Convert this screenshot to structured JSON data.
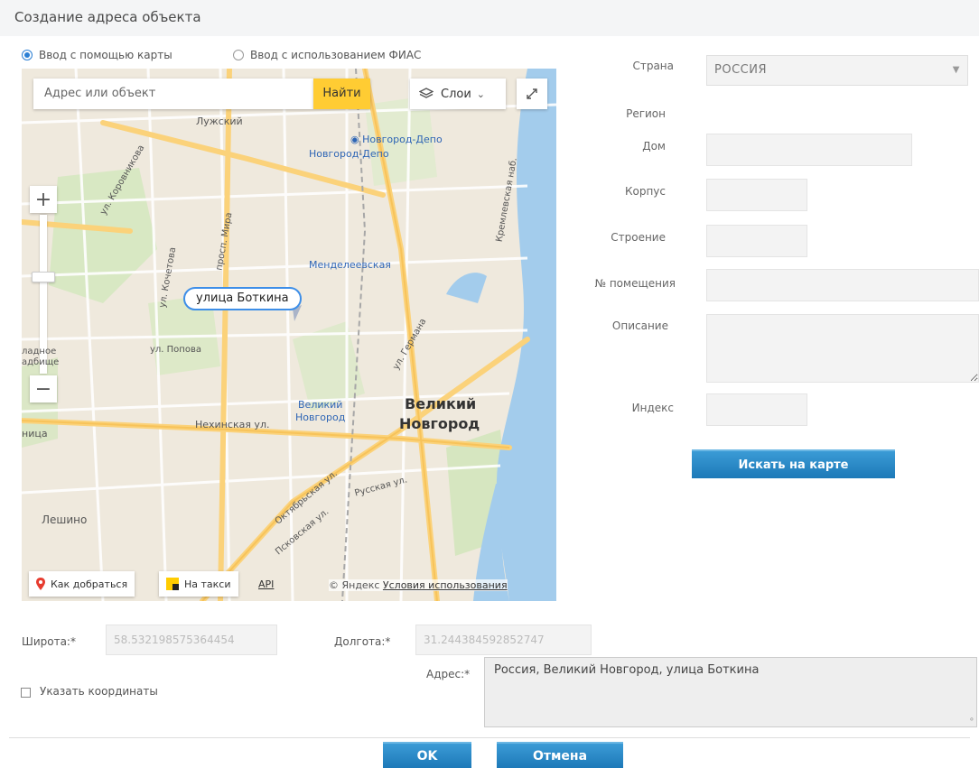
{
  "dialog": {
    "title": "Создание адреса объекта"
  },
  "input_mode": {
    "map_option": "Ввод с помощью карты",
    "fias_option": "Ввод с использованием ФИАС",
    "selected": "map"
  },
  "map": {
    "search_placeholder": "Адрес или объект",
    "find_label": "Найти",
    "layers_label": "Слои",
    "labels": {
      "luzhsky": "Лужский",
      "novgorod_depo_1": "Новгород-Депо",
      "novgorod_depo_2": "Новгород-Депо",
      "mendeleevskaya": "Менделеевская",
      "veliky_novgorod_station_1": "Великий",
      "veliky_novgorod_station_2": "Новгород",
      "city_1": "Великий",
      "city_2": "Новгород",
      "nekhinskaya": "Нехинская ул.",
      "popova": "ул. Попова",
      "leshino": "Лешино",
      "oktyabrskaya": "Октябрьская ул.",
      "pskovskaya": "Псковская ул.",
      "russkaya": "Русская ул.",
      "kholmskaya": "ул. Кочетова",
      "mira": "просп. Мира",
      "germana": "ул. Германа",
      "nitsa": "ница",
      "kladb_1": "ладное",
      "kladb_2": "адбище",
      "prosp_left": "ул. Коровникова",
      "kommun": "Кремлевская наб."
    },
    "street_bubble": "улица Боткина",
    "route_btn": "Как добраться",
    "taxi_btn": "На такси",
    "api_link": "API",
    "copyright": "© Яндекс",
    "terms": "Условия использования"
  },
  "form": {
    "country_label": "Страна",
    "country_value": "РОССИЯ",
    "region_label": "Регион",
    "house_label": "Дом",
    "building_label": "Корпус",
    "structure_label": "Строение",
    "room_label": "№ помещения",
    "description_label": "Описание",
    "index_label": "Индекс",
    "search_on_map": "Искать на карте"
  },
  "coords": {
    "lat_label": "Широта:*",
    "lat_value": "58.532198575364454",
    "lon_label": "Долгота:*",
    "lon_value": "31.244384592852747",
    "specify_label": "Указать координаты",
    "address_label": "Адрес:*",
    "address_value": "Россия, Великий Новгород, улица Боткина"
  },
  "actions": {
    "ok": "OK",
    "cancel": "Отмена"
  },
  "colors": {
    "accent": "#2b7fd4",
    "button": "#1d79b8",
    "find": "#ffcc33",
    "water": "#a3ccec",
    "road": "#fbd27a"
  }
}
